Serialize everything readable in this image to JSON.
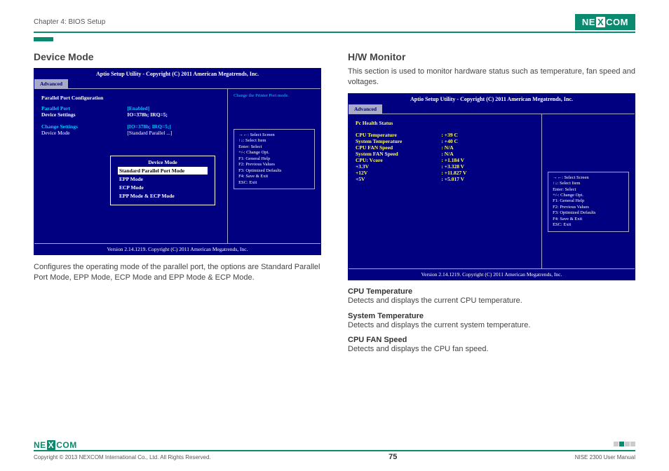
{
  "header": {
    "chapter": "Chapter 4: BIOS Setup",
    "brand": "NEXCOM"
  },
  "left": {
    "title": "Device Mode",
    "desc": "Configures the operating mode of the parallel port, the options are Standard Parallel Port Mode, EPP Mode, ECP Mode and EPP Mode & ECP Mode."
  },
  "right": {
    "title": "H/W Monitor",
    "intro": "This section is used to monitor hardware status such as temperature, fan speed and voltages.",
    "entries": [
      {
        "h": "CPU Temperature",
        "d": "Detects and displays the current CPU temperature."
      },
      {
        "h": "System Temperature",
        "d": "Detects and displays the current system temperature."
      },
      {
        "h": "CPU FAN Speed",
        "d": "Detects and displays the CPU fan speed."
      }
    ]
  },
  "bios_common": {
    "title": "Aptio Setup Utility - Copyright (C) 2011 American Megatrends, Inc.",
    "tab": "Advanced",
    "footer": "Version 2.14.1219. Copyright (C) 2011 American Megatrends, Inc.",
    "help": [
      "→←: Select Screen",
      "↑↓: Select Item",
      "Enter: Select",
      "+/-: Change Opt.",
      "F1: General Help",
      "F2: Previous Values",
      "F3: Optimized Defaults",
      "F4: Save & Exit",
      "ESC: Exit"
    ]
  },
  "bios1": {
    "hint": "Change the Printer Port mode.",
    "heading": "Parallel Port Configuration",
    "rows": [
      {
        "lbl": "Parallel Port",
        "val": "[Enabled]",
        "style": "cyan"
      },
      {
        "lbl": "Device Settings",
        "val": "IO=378h; IRQ=5;",
        "style": "white"
      },
      {
        "lbl": "",
        "val": "",
        "style": "white"
      },
      {
        "lbl": "Change Settings",
        "val": "[IO=378h; IRQ=5;]",
        "style": "cyan"
      },
      {
        "lbl": "Device Mode",
        "val": "[Standard Parallel ...]",
        "style": "white"
      }
    ],
    "popup": {
      "title": "Device Mode",
      "selected": "Standard Parallel Port Mode",
      "options": [
        "EPP Mode",
        "ECP Mode",
        "EPP Mode & ECP Mode"
      ]
    }
  },
  "bios2": {
    "heading": "Pc Health Status",
    "rows": [
      {
        "lbl": "CPU Temperature",
        "val": ":  +39 C"
      },
      {
        "lbl": "System Temperature",
        "val": ":  +40 C"
      },
      {
        "lbl": "CPU FAN Speed",
        "val": ":  N/A"
      },
      {
        "lbl": "System FAN Speed",
        "val": ":  N/A"
      },
      {
        "lbl": "CPU: Vcore",
        "val": ":  +1.184 V"
      },
      {
        "lbl": "+3.3V",
        "val": ":  +3.328 V"
      },
      {
        "lbl": "+12V",
        "val": ":  +11.827 V"
      },
      {
        "lbl": "+5V",
        "val": ":  +5.017 V"
      }
    ]
  },
  "footer": {
    "copyright": "Copyright © 2013 NEXCOM International Co., Ltd. All Rights Reserved.",
    "page": "75",
    "manual": "NISE 2300 User Manual"
  }
}
